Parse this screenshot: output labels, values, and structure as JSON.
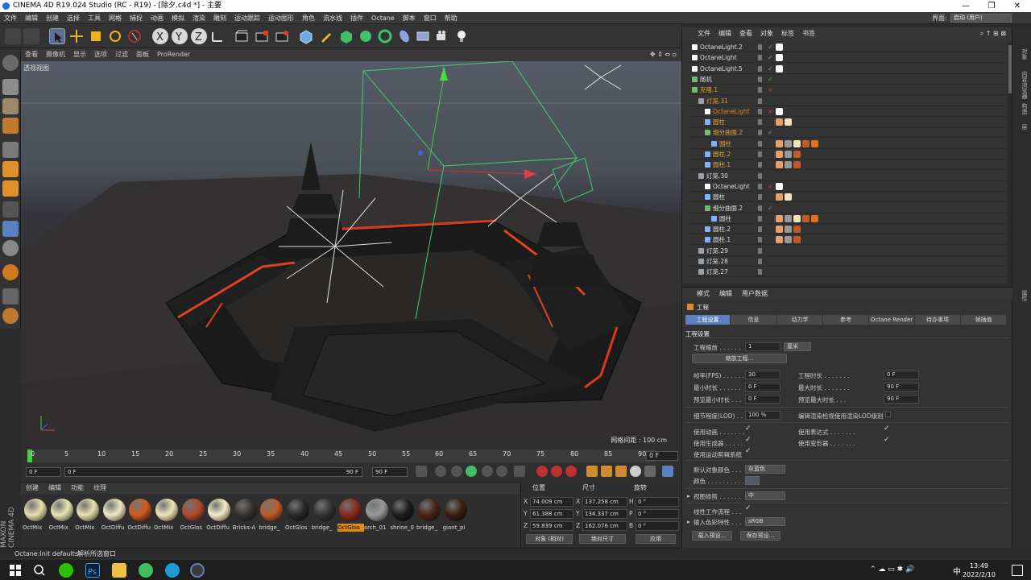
{
  "window": {
    "title": "CINEMA 4D R19.024 Studio (RC - R19) - [除夕.c4d *] - 主要",
    "minimize": "—",
    "maximize": "❐",
    "close": "✕"
  },
  "menubar": {
    "items": [
      "文件",
      "编辑",
      "创建",
      "选择",
      "工具",
      "网格",
      "捕捉",
      "动画",
      "模拟",
      "渲染",
      "雕刻",
      "运动跟踪",
      "运动图形",
      "角色",
      "流水线",
      "插件",
      "Octane",
      "脚本",
      "窗口",
      "帮助"
    ],
    "layout_label": "界面:",
    "layout_value": "启动 (用户)"
  },
  "toolbar": {
    "undo": "undo-icon",
    "redo": "redo-icon",
    "tools": [
      "select-cursor-icon",
      "move-icon",
      "scale-icon",
      "rotate-icon",
      "live-select-icon",
      "x-axis-icon",
      "y-axis-icon",
      "z-axis-icon",
      "world-coord-icon",
      "render-view-icon",
      "render-picture-icon",
      "render-settings-icon",
      "cube-icon",
      "pen-icon",
      "subdivision-icon",
      "cloner-icon",
      "deformer-icon",
      "scene-icon",
      "camera-icon",
      "light-icon"
    ]
  },
  "viewport": {
    "menu": [
      "查看",
      "摄像机",
      "显示",
      "选项",
      "过滤",
      "面板",
      "ProRender"
    ],
    "label": "透视视图",
    "grid_spacing": "网格间距 : 100 cm"
  },
  "timeline": {
    "ticks": [
      "0",
      "5",
      "10",
      "15",
      "20",
      "25",
      "30",
      "35",
      "40",
      "45",
      "50",
      "55",
      "60",
      "65",
      "70",
      "75",
      "80",
      "85",
      "90"
    ],
    "current_frame": "0 F",
    "start": "0 F",
    "range_start": "0 F",
    "range_end": "90 F",
    "end": "90 F"
  },
  "materials": {
    "menu": [
      "创建",
      "编辑",
      "功能",
      "纹理"
    ],
    "items": [
      {
        "label": "OctMix",
        "color": "#e8dfae"
      },
      {
        "label": "OctMix",
        "color": "#eae2b4"
      },
      {
        "label": "OctMix",
        "color": "#e9e0b0"
      },
      {
        "label": "OctDiffu",
        "color": "#f2e7c4"
      },
      {
        "label": "OctDiffu",
        "color": "#d25a1f"
      },
      {
        "label": "OctMix",
        "color": "#efe4b8"
      },
      {
        "label": "OctGlos",
        "color": "#b04a2a"
      },
      {
        "label": "OctDiffu",
        "color": "#f5ecc6"
      },
      {
        "label": "Bricks-A",
        "color": "#3a3230"
      },
      {
        "label": "bridge_",
        "color": "#c05a2a"
      },
      {
        "label": "OctGlos",
        "color": "#2a2a2a"
      },
      {
        "label": "bridge_",
        "color": "#343434"
      },
      {
        "label": "OctGlos",
        "color": "#8a2a1c"
      },
      {
        "label": "arch_01",
        "color": "#9a9a9a"
      },
      {
        "label": "shrine_0",
        "color": "#1e1e1e"
      },
      {
        "label": "bridge_",
        "color": "#4a2418"
      },
      {
        "label": "giant_pi",
        "color": "#3a1e14"
      }
    ],
    "selected_index": 12
  },
  "coordinates": {
    "headers": [
      "位置",
      "尺寸",
      "旋转"
    ],
    "rows": [
      {
        "axis": "X",
        "pos": "74.009 cm",
        "size_axis": "X",
        "size": "137.258 cm",
        "rot_axis": "H",
        "rot": "0 °"
      },
      {
        "axis": "Y",
        "pos": "61.388 cm",
        "size_axis": "Y",
        "size": "134.337 cm",
        "rot_axis": "P",
        "rot": "0 °"
      },
      {
        "axis": "Z",
        "pos": "59.839 cm",
        "size_axis": "Z",
        "size": "162.076 cm",
        "rot_axis": "B",
        "rot": "0 °"
      }
    ],
    "mode": "对象 (相对)",
    "size_mode": "绝对尺寸",
    "apply": "应用"
  },
  "status": {
    "left": "Octane:Init defaults",
    "right": "解析所选窗口"
  },
  "object_manager": {
    "menu": [
      "文件",
      "编辑",
      "查看",
      "对象",
      "标签",
      "书签"
    ],
    "rows": [
      {
        "name": "OctaneLight.2",
        "indent": 0,
        "color": "#ddd",
        "icon": "#ffffff",
        "check": "✓",
        "tags": [
          "#ffffff"
        ]
      },
      {
        "name": "OctaneLight",
        "indent": 0,
        "color": "#ddd",
        "icon": "#ffffff",
        "check": "✓",
        "tags": [
          "#ffffff"
        ]
      },
      {
        "name": "OctaneLight.5",
        "indent": 0,
        "color": "#ddd",
        "icon": "#ffffff",
        "check": "✓",
        "tags": [
          "#ffffff"
        ]
      },
      {
        "name": "随机",
        "indent": 0,
        "color": "#ddd",
        "icon": "#6fbf6f",
        "check": "✓",
        "tags": []
      },
      {
        "name": "克隆.1",
        "indent": 0,
        "color": "#e0a030",
        "icon": "#6fbf6f",
        "check": "×",
        "tags": []
      },
      {
        "name": "灯笼.31",
        "indent": 1,
        "color": "#e0a030",
        "icon": "#9aa0a8",
        "check": "",
        "tags": []
      },
      {
        "name": "OctaneLight",
        "indent": 2,
        "color": "#e08020",
        "icon": "#ffffff",
        "check": "×",
        "tags": [
          "#ffffff"
        ]
      },
      {
        "name": "圆柱",
        "indent": 2,
        "color": "#e0a030",
        "icon": "#7fb2ff",
        "check": "",
        "tags": [
          "#e6a070",
          "#f2e4b8"
        ]
      },
      {
        "name": "细分曲面.2",
        "indent": 2,
        "color": "#e0a030",
        "icon": "#6fbf6f",
        "check": "✓",
        "tags": []
      },
      {
        "name": "圆柱",
        "indent": 3,
        "color": "#e0a030",
        "icon": "#7fb2ff",
        "check": "",
        "tags": [
          "#e6a070",
          "#999",
          "#f2e4b8",
          "#c05a2a",
          "#e07020"
        ]
      },
      {
        "name": "圆柱.2",
        "indent": 2,
        "color": "#e0a030",
        "icon": "#7fb2ff",
        "check": "",
        "tags": [
          "#e6a070",
          "#999",
          "#c05a2a"
        ]
      },
      {
        "name": "圆柱.1",
        "indent": 2,
        "color": "#e0a030",
        "icon": "#7fb2ff",
        "check": "",
        "tags": [
          "#e6a070",
          "#999",
          "#c05a2a"
        ]
      },
      {
        "name": "灯笼.30",
        "indent": 1,
        "color": "#ddd",
        "icon": "#9aa0a8",
        "check": "",
        "tags": []
      },
      {
        "name": "OctaneLight",
        "indent": 2,
        "color": "#ddd",
        "icon": "#ffffff",
        "check": "×",
        "tags": [
          "#ffffff"
        ]
      },
      {
        "name": "圆柱",
        "indent": 2,
        "color": "#ddd",
        "icon": "#7fb2ff",
        "check": "",
        "tags": [
          "#e6a070",
          "#f2e4b8"
        ]
      },
      {
        "name": "细分曲面.2",
        "indent": 2,
        "color": "#ddd",
        "icon": "#6fbf6f",
        "check": "✓",
        "tags": []
      },
      {
        "name": "圆柱",
        "indent": 3,
        "color": "#ddd",
        "icon": "#7fb2ff",
        "check": "",
        "tags": [
          "#e6a070",
          "#999",
          "#f2e4b8",
          "#c05a2a",
          "#e07020"
        ]
      },
      {
        "name": "圆柱.2",
        "indent": 2,
        "color": "#ddd",
        "icon": "#7fb2ff",
        "check": "",
        "tags": [
          "#e6a070",
          "#999",
          "#c05a2a"
        ]
      },
      {
        "name": "圆柱.1",
        "indent": 2,
        "color": "#ddd",
        "icon": "#7fb2ff",
        "check": "",
        "tags": [
          "#e6a070",
          "#999",
          "#c05a2a"
        ]
      },
      {
        "name": "灯笼.29",
        "indent": 1,
        "color": "#ddd",
        "icon": "#9aa0a8",
        "check": "",
        "tags": []
      },
      {
        "name": "灯笼.28",
        "indent": 1,
        "color": "#ddd",
        "icon": "#9aa0a8",
        "check": "",
        "tags": []
      },
      {
        "name": "灯笼.27",
        "indent": 1,
        "color": "#ddd",
        "icon": "#9aa0a8",
        "check": "",
        "tags": []
      }
    ]
  },
  "side_tabs": [
    "对象",
    "内容浏览器",
    "构造",
    "层",
    "属性"
  ],
  "attributes": {
    "menu": [
      "模式",
      "编辑",
      "用户数据"
    ],
    "header": "工程",
    "tabs": [
      "工程设置",
      "信息",
      "动力学",
      "参考",
      "Octane Render",
      "待办事项",
      "帧插值"
    ],
    "active_tab": 0,
    "section": "工程设置",
    "scale_label": "工程缩放 . . . . . .",
    "scale_value": "1",
    "scale_unit": "厘米",
    "scale_btn": "缩放工程...",
    "fps_label": "帧率(FPS) . . . . . .",
    "fps_value": "30",
    "proj_len_label": "工程时长 . . . . . . .",
    "proj_len_value": "0 F",
    "min_len_label": "最小时长 . . . . . .",
    "min_len_value": "0 F",
    "max_len_label": "最大时长 . . . . . . .",
    "max_len_value": "90 F",
    "prev_min_label": "预览最小时长 . . .",
    "prev_min_value": "0 F",
    "prev_max_label": "预览最大时长 . . .",
    "prev_max_value": "90 F",
    "lod_label": "细节程度(LOD) . .",
    "lod_value": "100 %",
    "lod_edit_label": "编辑渲染检视使用渲染LOD级别",
    "use_anim": "使用动画 . . . . . . .",
    "use_expr": "使用表达式 . . . . . . .",
    "use_gen": "使用生成器 . . . . .",
    "use_deform": "使用变形器 . . . . . . .",
    "use_mograph": "使用运动剪辑系统",
    "default_color_label": "默认对象颜色 . . .",
    "default_color_value": "灰蓝色",
    "color_label": "颜色 . . . . . . . . . .",
    "view_clip_label": "视图修剪 . . . . . .",
    "view_clip_value": "中",
    "linear_label": "线性工作流程 . . .",
    "input_color_label": "输入色彩特性 . . .",
    "input_color_value": "sRGB",
    "load_preset": "载入预设...",
    "save_preset": "保存预设..."
  },
  "taskbar": {
    "time": "13:49",
    "date": "2022/2/10",
    "ime": "中",
    "apps": [
      "windows-start-icon",
      "search-icon",
      "wechat-icon",
      "photoshop-icon",
      "file-explorer-icon",
      "app-green-icon",
      "browser-icon",
      "cinema4d-icon"
    ]
  }
}
